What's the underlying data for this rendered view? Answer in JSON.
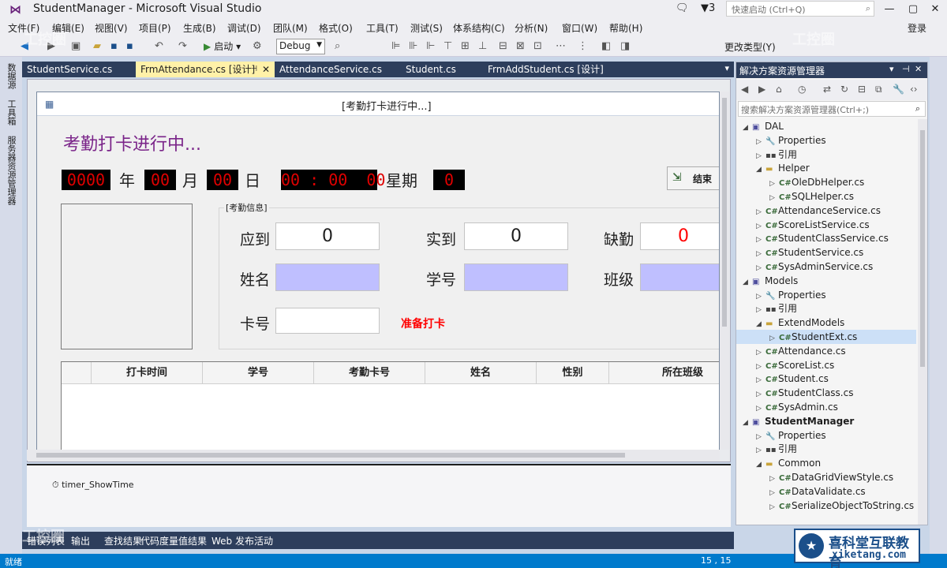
{
  "window": {
    "title": "StudentManager - Microsoft Visual Studio",
    "notification_count": "3",
    "quick_launch_placeholder": "快速启动 (Ctrl+Q)",
    "login_label": "登录"
  },
  "menu": [
    "文件(F)",
    "编辑(E)",
    "视图(V)",
    "项目(P)",
    "生成(B)",
    "调试(D)",
    "团队(M)",
    "格式(O)",
    "工具(T)",
    "测试(S)",
    "体系结构(C)",
    "分析(N)",
    "窗口(W)",
    "帮助(H)"
  ],
  "toolbar": {
    "start_label": "启动",
    "config_value": "Debug",
    "change_type_label": "更改类型(Y)"
  },
  "left_strip": [
    "数据源",
    "工具箱",
    "服务器资源管理器"
  ],
  "doc_tabs": [
    {
      "label": "StudentService.cs",
      "active": false
    },
    {
      "label": "FrmAttendance.cs [设计]",
      "active": true
    },
    {
      "label": "AttendanceService.cs",
      "active": false
    },
    {
      "label": "Student.cs",
      "active": false
    },
    {
      "label": "FrmAddStudent.cs [设计]",
      "active": false
    }
  ],
  "form": {
    "title": "[考勤打卡进行中...]",
    "heading": "考勤打卡进行中...",
    "date": {
      "year": "0000",
      "year_unit": "年",
      "month": "00",
      "month_unit": "月",
      "day": "00",
      "day_unit": "日"
    },
    "time": "00 : 00  00",
    "weekday_label": "星期",
    "weekday": "0",
    "end_button": "结束",
    "group_title": "[考勤信息]",
    "fields": {
      "should_label": "应到",
      "should_value": "0",
      "actual_label": "实到",
      "actual_value": "0",
      "absent_label": "缺勤",
      "absent_value": "0",
      "name_label": "姓名",
      "student_id_label": "学号",
      "class_label": "班级",
      "card_label": "卡号"
    },
    "ready_label": "准备打卡",
    "grid_columns": [
      "打卡时间",
      "学号",
      "考勤卡号",
      "姓名",
      "性别",
      "所在班级"
    ]
  },
  "tray": {
    "timer": "timer_ShowTime"
  },
  "bottom_tabs": [
    "错误列表",
    "输出",
    "查找结果",
    "代码度量值结果",
    "Web 发布活动"
  ],
  "solution_explorer": {
    "title": "解决方案资源管理器",
    "search_placeholder": "搜索解决方案资源管理器(Ctrl+;)",
    "tree": [
      {
        "label": "DAL",
        "level": 0,
        "icon": "project",
        "expanded": true
      },
      {
        "label": "Properties",
        "level": 1,
        "icon": "properties"
      },
      {
        "label": "引用",
        "level": 1,
        "icon": "references"
      },
      {
        "label": "Helper",
        "level": 1,
        "icon": "folder",
        "expanded": true
      },
      {
        "label": "OleDbHelper.cs",
        "level": 2,
        "icon": "csharp"
      },
      {
        "label": "SQLHelper.cs",
        "level": 2,
        "icon": "csharp"
      },
      {
        "label": "AttendanceService.cs",
        "level": 1,
        "icon": "csharp"
      },
      {
        "label": "ScoreListService.cs",
        "level": 1,
        "icon": "csharp"
      },
      {
        "label": "StudentClassService.cs",
        "level": 1,
        "icon": "csharp"
      },
      {
        "label": "StudentService.cs",
        "level": 1,
        "icon": "csharp"
      },
      {
        "label": "SysAdminService.cs",
        "level": 1,
        "icon": "csharp"
      },
      {
        "label": "Models",
        "level": 0,
        "icon": "project",
        "expanded": true
      },
      {
        "label": "Properties",
        "level": 1,
        "icon": "properties"
      },
      {
        "label": "引用",
        "level": 1,
        "icon": "references"
      },
      {
        "label": "ExtendModels",
        "level": 1,
        "icon": "folder",
        "expanded": true
      },
      {
        "label": "StudentExt.cs",
        "level": 2,
        "icon": "csharp",
        "selected": true
      },
      {
        "label": "Attendance.cs",
        "level": 1,
        "icon": "csharp"
      },
      {
        "label": "ScoreList.cs",
        "level": 1,
        "icon": "csharp"
      },
      {
        "label": "Student.cs",
        "level": 1,
        "icon": "csharp"
      },
      {
        "label": "StudentClass.cs",
        "level": 1,
        "icon": "csharp"
      },
      {
        "label": "SysAdmin.cs",
        "level": 1,
        "icon": "csharp"
      },
      {
        "label": "StudentManager",
        "level": 0,
        "icon": "project",
        "expanded": true,
        "bold": true
      },
      {
        "label": "Properties",
        "level": 1,
        "icon": "properties"
      },
      {
        "label": "引用",
        "level": 1,
        "icon": "references"
      },
      {
        "label": "Common",
        "level": 1,
        "icon": "folder",
        "expanded": true
      },
      {
        "label": "DataGridViewStyle.cs",
        "level": 2,
        "icon": "csharp"
      },
      {
        "label": "DataValidate.cs",
        "level": 2,
        "icon": "csharp"
      },
      {
        "label": "SerializeObjectToString.cs",
        "level": 2,
        "icon": "csharp"
      }
    ]
  },
  "status": {
    "text": "就绪",
    "position": "15 , 15"
  },
  "watermarks": {
    "left": "工控圈",
    "logo_cn": "喜科堂互联教育",
    "logo_en": "xiketang.com"
  },
  "colors": {
    "accent": "#007acc",
    "tab_active": "#fff1a8",
    "heading": "#7a2489",
    "led_text": "#e00000",
    "ready": "#ff0000",
    "info_box": "#bfbfff"
  }
}
